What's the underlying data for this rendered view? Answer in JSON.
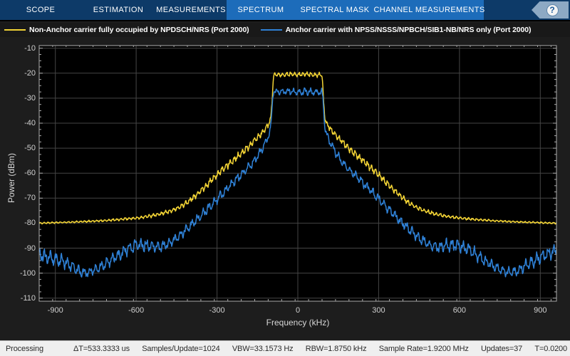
{
  "toolbar": {
    "tabs": [
      {
        "label": "SCOPE",
        "highlighted": false
      },
      {
        "label": "ESTIMATION",
        "highlighted": false
      },
      {
        "label": "MEASUREMENTS",
        "highlighted": false
      },
      {
        "label": "SPECTRUM",
        "highlighted": true
      },
      {
        "label": "SPECTRAL MASK",
        "highlighted": true
      },
      {
        "label": "CHANNEL MEASUREMENTS",
        "highlighted": true
      }
    ],
    "help_label": "?"
  },
  "legend": [
    {
      "label": "Non-Anchor carrier fully occupied by NPDSCH/NRS (Port 2000)",
      "color": "#f2d335"
    },
    {
      "label": "Anchor carrier with NPSS/NSSS/NPBCH/SIB1-NB/NRS only (Port 2000)",
      "color": "#2f81d6"
    }
  ],
  "status_bar": {
    "state": "Processing",
    "items": [
      "ΔT=533.3333 us",
      "Samples/Update=1024",
      "VBW=33.1573 Hz",
      "RBW=1.8750 kHz",
      "Sample Rate=1.9200 MHz",
      "Updates=37",
      "T=0.0200"
    ]
  },
  "chart_data": {
    "type": "line",
    "title": "",
    "xlabel": "Frequency (kHz)",
    "ylabel": "Power (dBm)",
    "xlim": [
      -960,
      960
    ],
    "ylim": [
      -110,
      -10
    ],
    "x_ticks": [
      -900,
      -600,
      -300,
      0,
      300,
      600,
      900
    ],
    "y_ticks": [
      -10,
      -20,
      -30,
      -40,
      -50,
      -60,
      -70,
      -80,
      -90,
      -100,
      -110
    ],
    "x_minor_step": 50,
    "y_minor_step": 2.5,
    "grid": true,
    "legend_position": "top",
    "colors": {
      "grid": "#454545",
      "axis": "#adadad",
      "plot_bg": "#000000",
      "figure_bg": "#1d1d1d"
    },
    "series": [
      {
        "name": "Non-Anchor carrier fully occupied by NPDSCH/NRS (Port 2000)",
        "color": "#f2d335",
        "ripple_period_khz": 15,
        "step": 1.5,
        "seed": 77,
        "envelope": [
          [
            -960,
            -80,
            0.4
          ],
          [
            -900,
            -79.8,
            0.4
          ],
          [
            -840,
            -79.6,
            0.4
          ],
          [
            -780,
            -79.3,
            0.5
          ],
          [
            -720,
            -79,
            0.5
          ],
          [
            -660,
            -78.5,
            0.6
          ],
          [
            -600,
            -78,
            0.7
          ],
          [
            -550,
            -77.2,
            0.8
          ],
          [
            -510,
            -76.3,
            0.9
          ],
          [
            -470,
            -75.1,
            1
          ],
          [
            -440,
            -73.7,
            1.1
          ],
          [
            -410,
            -71.7,
            1.2
          ],
          [
            -380,
            -69.1,
            1.4
          ],
          [
            -350,
            -66.1,
            1.5
          ],
          [
            -320,
            -62.8,
            1.6
          ],
          [
            -290,
            -59.6,
            1.7
          ],
          [
            -260,
            -56.8,
            1.7
          ],
          [
            -230,
            -54,
            1.7
          ],
          [
            -200,
            -51.2,
            1.7
          ],
          [
            -170,
            -48,
            1.6
          ],
          [
            -145,
            -45.2,
            1.5
          ],
          [
            -125,
            -42.9,
            1.5
          ],
          [
            -110,
            -40.7,
            1.3
          ],
          [
            -101,
            -38.5,
            1.1
          ],
          [
            -96,
            -32,
            0.9
          ],
          [
            -92,
            -23.8,
            0.7
          ],
          [
            -89,
            -20.6,
            1.1
          ],
          [
            -60,
            -20.7,
            1.1
          ],
          [
            -30,
            -20.4,
            1.1
          ],
          [
            0,
            -20.6,
            1.1
          ],
          [
            30,
            -20.4,
            1.1
          ],
          [
            60,
            -20.7,
            1.1
          ],
          [
            89,
            -20.6,
            1.1
          ],
          [
            92,
            -23.8,
            0.7
          ],
          [
            96,
            -32,
            0.9
          ],
          [
            101,
            -38.5,
            1.1
          ],
          [
            110,
            -40.7,
            1.3
          ],
          [
            125,
            -42.9,
            1.5
          ],
          [
            145,
            -45.2,
            1.5
          ],
          [
            170,
            -48,
            1.6
          ],
          [
            200,
            -51.2,
            1.7
          ],
          [
            230,
            -54,
            1.7
          ],
          [
            260,
            -56.8,
            1.7
          ],
          [
            290,
            -59.6,
            1.7
          ],
          [
            320,
            -62.8,
            1.6
          ],
          [
            350,
            -66.1,
            1.5
          ],
          [
            380,
            -69.1,
            1.4
          ],
          [
            410,
            -71.7,
            1.2
          ],
          [
            440,
            -73.7,
            1.1
          ],
          [
            470,
            -75.1,
            1
          ],
          [
            510,
            -76.3,
            0.9
          ],
          [
            550,
            -77.2,
            0.8
          ],
          [
            600,
            -78,
            0.7
          ],
          [
            660,
            -78.5,
            0.6
          ],
          [
            720,
            -79,
            0.5
          ],
          [
            780,
            -79.3,
            0.5
          ],
          [
            840,
            -79.6,
            0.4
          ],
          [
            900,
            -79.8,
            0.4
          ],
          [
            960,
            -80,
            0.4
          ]
        ]
      },
      {
        "name": "Anchor carrier with NPSS/NSSS/NPBCH/SIB1-NB/NRS only (Port 2000)",
        "color": "#2f81d6",
        "ripple_period_khz": 21,
        "step": 1.5,
        "seed": 913,
        "envelope": [
          [
            -960,
            -92.5,
            3.2
          ],
          [
            -930,
            -93.6,
            3.3
          ],
          [
            -900,
            -94.6,
            3.3
          ],
          [
            -870,
            -95.6,
            3.2
          ],
          [
            -840,
            -97.2,
            3
          ],
          [
            -810,
            -99.4,
            2.6
          ],
          [
            -780,
            -99.8,
            2.4
          ],
          [
            -750,
            -98.6,
            2.4
          ],
          [
            -720,
            -96.8,
            2.6
          ],
          [
            -690,
            -94.6,
            2.8
          ],
          [
            -660,
            -92.4,
            3
          ],
          [
            -630,
            -90.3,
            3.1
          ],
          [
            -600,
            -88.9,
            3.2
          ],
          [
            -570,
            -88.6,
            3.2
          ],
          [
            -540,
            -89.3,
            3
          ],
          [
            -515,
            -89.7,
            2.8
          ],
          [
            -490,
            -88.8,
            2.6
          ],
          [
            -465,
            -87.1,
            2.5
          ],
          [
            -440,
            -85,
            2.4
          ],
          [
            -410,
            -82.2,
            2.4
          ],
          [
            -380,
            -79.2,
            2.4
          ],
          [
            -350,
            -76,
            2.4
          ],
          [
            -320,
            -72.6,
            2.4
          ],
          [
            -290,
            -69.2,
            2.4
          ],
          [
            -260,
            -65.8,
            2.4
          ],
          [
            -230,
            -62.6,
            2.3
          ],
          [
            -200,
            -59.6,
            2.3
          ],
          [
            -170,
            -56.2,
            2.2
          ],
          [
            -145,
            -52.6,
            2.1
          ],
          [
            -125,
            -48.8,
            2
          ],
          [
            -112,
            -46,
            1.8
          ],
          [
            -102,
            -42.5,
            1.5
          ],
          [
            -97,
            -37,
            1.2
          ],
          [
            -93,
            -29.5,
            1
          ],
          [
            -89,
            -27.3,
            1.7
          ],
          [
            -60,
            -27.5,
            1.7
          ],
          [
            -30,
            -27.2,
            1.7
          ],
          [
            0,
            -27.8,
            1.7
          ],
          [
            30,
            -27.3,
            1.7
          ],
          [
            60,
            -27.6,
            1.7
          ],
          [
            89,
            -27.5,
            1.7
          ],
          [
            93,
            -29.5,
            1
          ],
          [
            97,
            -37,
            1.2
          ],
          [
            102,
            -42.5,
            1.5
          ],
          [
            112,
            -46,
            1.8
          ],
          [
            125,
            -48.8,
            2
          ],
          [
            145,
            -52.6,
            2.1
          ],
          [
            170,
            -56.2,
            2.2
          ],
          [
            200,
            -59.6,
            2.3
          ],
          [
            230,
            -62.6,
            2.3
          ],
          [
            260,
            -65.8,
            2.4
          ],
          [
            290,
            -69.2,
            2.4
          ],
          [
            320,
            -72.6,
            2.4
          ],
          [
            350,
            -76,
            2.4
          ],
          [
            380,
            -79.2,
            2.4
          ],
          [
            410,
            -82.2,
            2.4
          ],
          [
            440,
            -85,
            2.4
          ],
          [
            465,
            -87.1,
            2.5
          ],
          [
            490,
            -88.8,
            2.6
          ],
          [
            515,
            -89.7,
            2.8
          ],
          [
            540,
            -89.3,
            3
          ],
          [
            570,
            -88.6,
            3.2
          ],
          [
            600,
            -88.9,
            3.2
          ],
          [
            630,
            -90.3,
            3.1
          ],
          [
            660,
            -92.4,
            3
          ],
          [
            690,
            -94.6,
            2.8
          ],
          [
            720,
            -96.8,
            2.6
          ],
          [
            750,
            -98.6,
            2.4
          ],
          [
            780,
            -99.8,
            2.4
          ],
          [
            810,
            -99.4,
            2.6
          ],
          [
            840,
            -97.2,
            3
          ],
          [
            870,
            -95.6,
            3.2
          ],
          [
            900,
            -93.8,
            3.3
          ],
          [
            930,
            -92,
            3.3
          ],
          [
            960,
            -90.8,
            3.2
          ]
        ]
      }
    ]
  }
}
